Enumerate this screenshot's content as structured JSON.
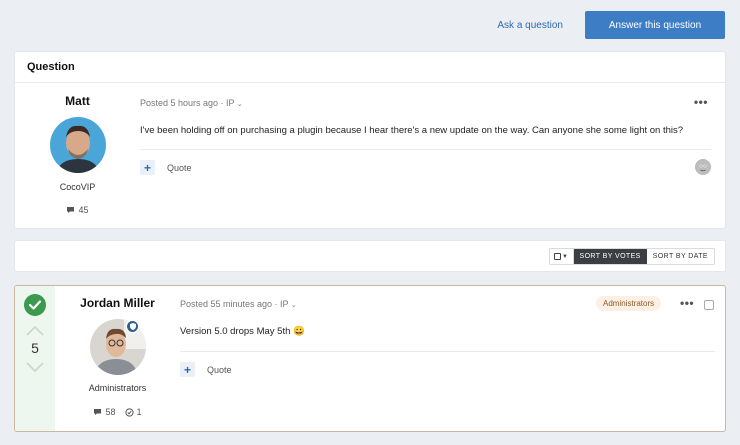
{
  "actions": {
    "ask_label": "Ask a question",
    "answer_label": "Answer this question"
  },
  "question": {
    "header": "Question",
    "author": {
      "name": "Matt",
      "group": "CocoVIP",
      "post_count": "45"
    },
    "meta": "Posted 5 hours ago · IP",
    "more": "•••",
    "text": "I've been holding off on purchasing a plugin because I hear there's a new update on the way. Can anyone she some light on this?",
    "plus": "+",
    "quote_label": "Quote"
  },
  "sort": {
    "by_votes": "SORT BY VOTES",
    "by_date": "SORT BY DATE"
  },
  "answer": {
    "votes": "5",
    "author": {
      "name": "Jordan Miller",
      "group": "Administrators",
      "post_count": "58",
      "solutions": "1"
    },
    "meta": "Posted 55 minutes ago · IP",
    "badge": "Administrators",
    "more": "•••",
    "text": "Version 5.0 drops May 5th 😀",
    "plus": "+",
    "quote_label": "Quote"
  },
  "colors": {
    "accent": "#3c7dc6",
    "solved_green": "#3c9a4f",
    "admin_badge_bg": "#fcefe3"
  }
}
